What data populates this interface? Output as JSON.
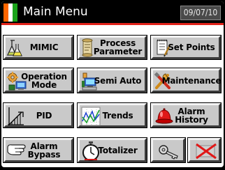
{
  "header": {
    "title": "Main Menu",
    "date": "09/07/10",
    "flag_colors": [
      "#ff6600",
      "#ffffff",
      "#1aa31a"
    ],
    "rule_color": "#e2231a"
  },
  "menu": {
    "mimic": "MIMIC",
    "process_parameter": "Process\nParameter",
    "set_points": "Set Points",
    "operation_mode": "Operation\nMode",
    "semi_auto": "Semi Auto",
    "maintenance": "Maintenance",
    "pid": "PID",
    "trends": "Trends",
    "alarm_history": "Alarm\nHistory",
    "alarm_bypass": "Alarm\nBypass",
    "totalizer": "Totalizer"
  },
  "icons": {
    "mimic": "flask-icon",
    "process_parameter": "scroll-icon",
    "set_points": "notepad-icon",
    "operation_mode": "gear-computer-icon",
    "semi_auto": "computer-icon",
    "maintenance": "tools-icon",
    "pid": "ramp-chart-icon",
    "trends": "trend-chart-icon",
    "alarm_history": "alarm-bell-icon",
    "alarm_bypass": "hand-icon",
    "totalizer": "stopwatch-icon",
    "login": "key-icon",
    "close": "close-x-icon"
  }
}
